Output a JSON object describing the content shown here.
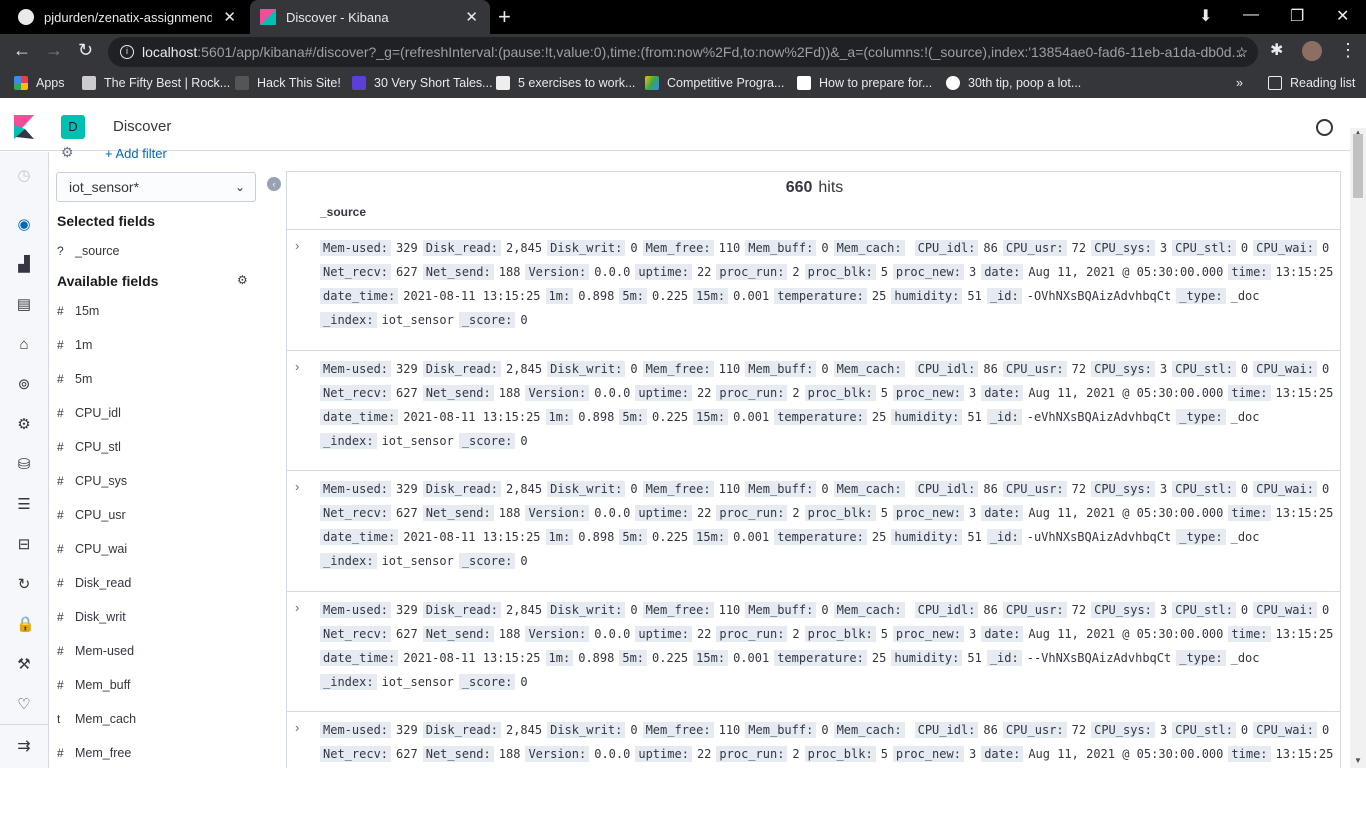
{
  "browser": {
    "tabs": [
      {
        "title": "pjdurden/zenatix-assignmendoc"
      },
      {
        "title": "Discover - Kibana"
      }
    ],
    "url_host": "localhost",
    "url_rest": ":5601/app/kibana#/discover?_g=(refreshInterval:(pause:!t,value:0),time:(from:now%2Fd,to:now%2Fd))&_a=(columns:!(_source),index:'13854ae0-fad6-11eb-a1da-db0d...",
    "bookmarks": [
      {
        "label": "Apps"
      },
      {
        "label": "The Fifty Best | Rock..."
      },
      {
        "label": "Hack This Site!"
      },
      {
        "label": "30 Very Short Tales..."
      },
      {
        "label": "5 exercises to work..."
      },
      {
        "label": "Competitive Progra..."
      },
      {
        "label": "How to prepare for..."
      },
      {
        "label": "30th tip, poop a lot..."
      }
    ],
    "reading_list": "Reading list"
  },
  "kibana": {
    "space_initial": "D",
    "app_title": "Discover",
    "add_filter": "+ Add filter",
    "index_pattern": "iot_sensor*",
    "selected_fields_title": "Selected fields",
    "selected_field": {
      "type": "?",
      "name": "_source"
    },
    "available_fields_title": "Available fields",
    "available_fields": [
      {
        "type": "#",
        "name": "15m"
      },
      {
        "type": "#",
        "name": "1m"
      },
      {
        "type": "#",
        "name": "5m"
      },
      {
        "type": "#",
        "name": "CPU_idl"
      },
      {
        "type": "#",
        "name": "CPU_stl"
      },
      {
        "type": "#",
        "name": "CPU_sys"
      },
      {
        "type": "#",
        "name": "CPU_usr"
      },
      {
        "type": "#",
        "name": "CPU_wai"
      },
      {
        "type": "#",
        "name": "Disk_read"
      },
      {
        "type": "#",
        "name": "Disk_writ"
      },
      {
        "type": "#",
        "name": "Mem-used"
      },
      {
        "type": "#",
        "name": "Mem_buff"
      },
      {
        "type": "t",
        "name": "Mem_cach"
      },
      {
        "type": "#",
        "name": "Mem_free"
      }
    ],
    "hits_count": "660",
    "hits_label": "hits",
    "column_header": "_source"
  },
  "docs": [
    {
      "id": "-OVhNXsBQAizAdvhbqCt"
    },
    {
      "id": "-eVhNXsBQAizAdvhbqCt"
    },
    {
      "id": "-uVhNXsBQAizAdvhbqCt"
    },
    {
      "id": "--VhNXsBQAizAdvhbqCt"
    },
    {
      "id": ""
    }
  ],
  "doc_template": {
    "line1": [
      [
        "Mem-used:",
        "329"
      ],
      [
        "Disk_read:",
        "2,845"
      ],
      [
        "Disk_writ:",
        "0"
      ],
      [
        "Mem_free:",
        "110"
      ],
      [
        "Mem_buff:",
        "0"
      ],
      [
        "Mem_cach:",
        ""
      ],
      [
        "CPU_idl:",
        "86"
      ],
      [
        "CPU_usr:",
        "72"
      ],
      [
        "CPU_sys:",
        "3"
      ],
      [
        "CPU_stl:",
        "0"
      ],
      [
        "CPU_wai:",
        "0"
      ]
    ],
    "line2": [
      [
        "Net_recv:",
        "627"
      ],
      [
        "Net_send:",
        "188"
      ],
      [
        "Version:",
        "0.0.0"
      ],
      [
        "uptime:",
        "22"
      ],
      [
        "proc_run:",
        "2"
      ],
      [
        "proc_blk:",
        "5"
      ],
      [
        "proc_new:",
        "3"
      ],
      [
        "date:",
        "Aug 11, 2021 @ 05:30:00.000"
      ],
      [
        "time:",
        "13:15:25"
      ]
    ],
    "line3": [
      [
        "date_time:",
        "2021-08-11 13:15:25"
      ],
      [
        "1m:",
        "0.898"
      ],
      [
        "5m:",
        "0.225"
      ],
      [
        "15m:",
        "0.001"
      ],
      [
        "temperature:",
        "25"
      ],
      [
        "humidity:",
        "51"
      ],
      [
        "_id:",
        "{ID}"
      ],
      [
        "_type:",
        "_doc"
      ]
    ],
    "line4": [
      [
        "_index:",
        "iot_sensor"
      ],
      [
        "_score:",
        "0"
      ]
    ]
  }
}
